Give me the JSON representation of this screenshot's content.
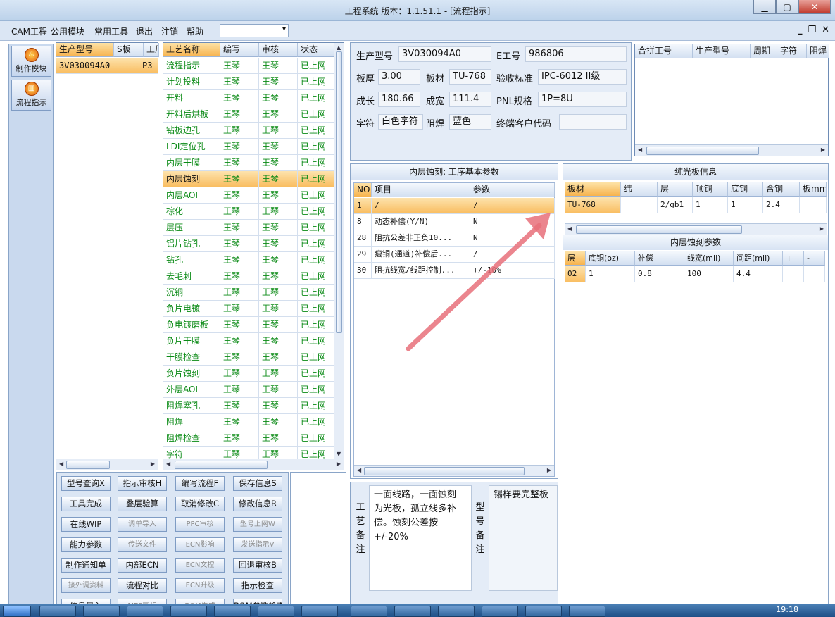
{
  "window": {
    "title": "工程系统  版本：1.1.51.1 - [流程指示]"
  },
  "menu": {
    "items": [
      "CAM工程",
      "公用模块",
      "常用工具",
      "退出",
      "注销",
      "帮助"
    ]
  },
  "dock": {
    "items": [
      {
        "label": "制作模块"
      },
      {
        "label": "流程指示"
      }
    ]
  },
  "model_list": {
    "headers": [
      "生产型号",
      "S板",
      "工厂"
    ],
    "rows": [
      [
        "3V030094A0",
        "",
        "P3"
      ]
    ]
  },
  "process_list": {
    "headers": [
      "工艺名称",
      "编写",
      "审核",
      "状态"
    ],
    "rows": [
      [
        "流程指示",
        "王琴",
        "王琴",
        "已上网"
      ],
      [
        "计划投料",
        "王琴",
        "王琴",
        "已上网"
      ],
      [
        "开料",
        "王琴",
        "王琴",
        "已上网"
      ],
      [
        "开料后烘板",
        "王琴",
        "王琴",
        "已上网"
      ],
      [
        "钻板边孔",
        "王琴",
        "王琴",
        "已上网"
      ],
      [
        "LDI定位孔",
        "王琴",
        "王琴",
        "已上网"
      ],
      [
        "内层干膜",
        "王琴",
        "王琴",
        "已上网"
      ],
      [
        "内层蚀刻",
        "王琴",
        "王琴",
        "已上网"
      ],
      [
        "内层AOI",
        "王琴",
        "王琴",
        "已上网"
      ],
      [
        "棕化",
        "王琴",
        "王琴",
        "已上网"
      ],
      [
        "层压",
        "王琴",
        "王琴",
        "已上网"
      ],
      [
        "铝片钻孔",
        "王琴",
        "王琴",
        "已上网"
      ],
      [
        "钻孔",
        "王琴",
        "王琴",
        "已上网"
      ],
      [
        "去毛刺",
        "王琴",
        "王琴",
        "已上网"
      ],
      [
        "沉铜",
        "王琴",
        "王琴",
        "已上网"
      ],
      [
        "负片电镀",
        "王琴",
        "王琴",
        "已上网"
      ],
      [
        "负电镀磨板",
        "王琴",
        "王琴",
        "已上网"
      ],
      [
        "负片干膜",
        "王琴",
        "王琴",
        "已上网"
      ],
      [
        "干膜检查",
        "王琴",
        "王琴",
        "已上网"
      ],
      [
        "负片蚀刻",
        "王琴",
        "王琴",
        "已上网"
      ],
      [
        "外层AOI",
        "王琴",
        "王琴",
        "已上网"
      ],
      [
        "阻焊塞孔",
        "王琴",
        "王琴",
        "已上网"
      ],
      [
        "阻焊",
        "王琴",
        "王琴",
        "已上网"
      ],
      [
        "阻焊检查",
        "王琴",
        "王琴",
        "已上网"
      ],
      [
        "字符",
        "王琴",
        "王琴",
        "已上网"
      ]
    ],
    "selected_index": 7
  },
  "actions": [
    [
      "型号查询X",
      "指示审核H",
      "编写流程F",
      "保存信息S"
    ],
    [
      "工具完成",
      "叠层验算",
      "取消修改C",
      "修改信息R"
    ],
    [
      "在线WIP",
      "调单导入",
      "PPC审核",
      "型号上网W"
    ],
    [
      "能力参数",
      "传送文件",
      "ECN影响",
      "发送指示V"
    ],
    [
      "制作通知单",
      "内部ECN",
      "ECN文控",
      "回退审核B"
    ],
    [
      "接外调资料",
      "流程对比",
      "ECN升级",
      "指示检查"
    ],
    [
      "信息导入",
      "MES同步",
      "BOM生成",
      "BOM参数检查"
    ]
  ],
  "actions_disabled": [
    "调单导入",
    "PPC审核",
    "型号上网W",
    "传送文件",
    "ECN影响",
    "发送指示V",
    "ECN文控",
    "ECN升级",
    "接外调资料",
    "MES同步",
    "BOM生成"
  ],
  "info": {
    "model_label": "生产型号",
    "model": "3V030094A0",
    "eng_label": "E工号",
    "eng": "986806",
    "thick_label": "板厚",
    "thick": "3.00",
    "mat_label": "板材",
    "mat": "TU-768",
    "std_label": "验收标准",
    "std": "IPC-6012 II级",
    "len_label": "成长",
    "len": "180.66",
    "wid_label": "成宽",
    "wid": "111.4",
    "pnl_label": "PNL规格",
    "pnl": "1P=8U",
    "char_label": "字符",
    "char": "白色字符",
    "mask_label": "阻焊",
    "mask": "蓝色",
    "cust_label": "终端客户代码",
    "cust": ""
  },
  "merge": {
    "headers": [
      "合拼工号",
      "生产型号",
      "周期",
      "字符",
      "阻焊"
    ]
  },
  "params": {
    "title": "内层蚀刻: 工序基本参数",
    "headers": [
      "NO",
      "项目",
      "参数"
    ],
    "rows": [
      [
        "1",
        "/",
        "/"
      ],
      [
        "8",
        "动态补偿(Y/N)",
        "N"
      ],
      [
        "28",
        "阻抗公差非正负10...",
        "N"
      ],
      [
        "29",
        "瘦铜(通道)补偿后...",
        "/"
      ],
      [
        "30",
        "阻抗线宽/线距控制...",
        "+/-10%"
      ]
    ]
  },
  "board": {
    "title": "纯光板信息",
    "headers": [
      "板材",
      "纬",
      "层",
      "顶铜",
      "底铜",
      "含铜",
      "板mm"
    ],
    "rows": [
      [
        "TU-768",
        "",
        "2/gb1",
        "1",
        "1",
        "2.4",
        ""
      ]
    ]
  },
  "etch": {
    "title": "内层蚀刻参数",
    "headers": [
      "层",
      "底铜(oz)",
      "补偿",
      "线宽(mil)",
      "间距(mil)",
      "+",
      "-"
    ],
    "rows": [
      [
        "02",
        "1",
        "0.8",
        "100",
        "4.4",
        "",
        ""
      ]
    ]
  },
  "remarks": {
    "process_label": "工艺备注",
    "process_text": "一面线路，一面蚀刻为光板，孤立线多补偿。蚀刻公差按+/-20%",
    "model_label": "型号备注",
    "model_text": "锡样要完整板"
  },
  "taskbar": {
    "clock": "19:18"
  },
  "colors": {
    "accent": "#f7b34e",
    "status_green": "#0a8a15",
    "annotation_arrow": "#e8707a"
  }
}
